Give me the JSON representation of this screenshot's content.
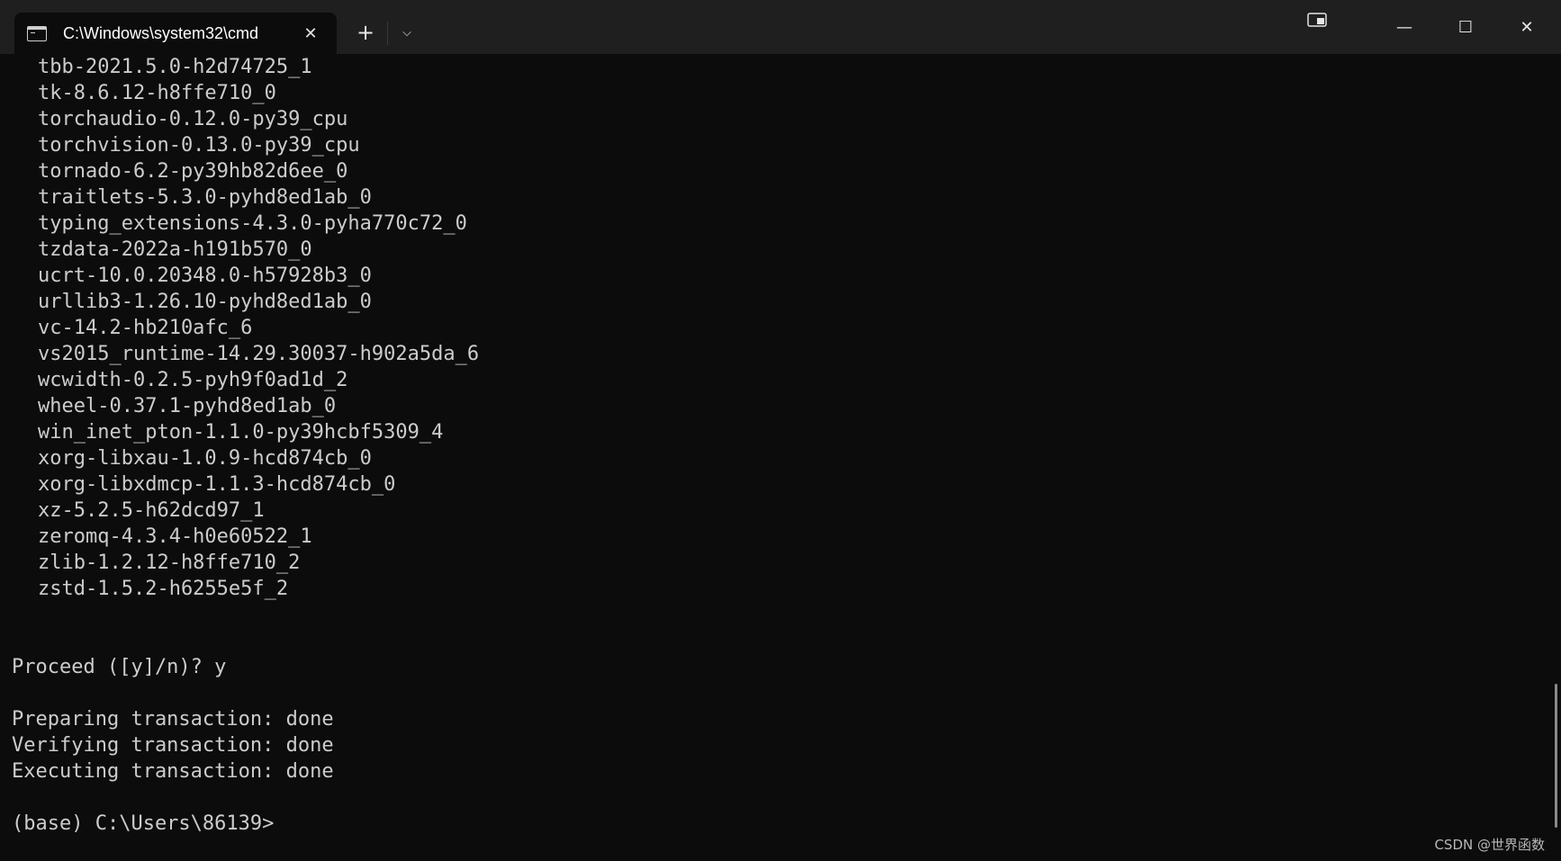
{
  "window": {
    "tab_title": "C:\\Windows\\system32\\cmd",
    "tab_close_glyph": "✕",
    "new_tab_glyph": "+",
    "dropdown_glyph": "⌵",
    "minimize_glyph": "—",
    "maximize_glyph": "☐",
    "close_glyph": "✕"
  },
  "terminal": {
    "packages": [
      "tbb-2021.5.0-h2d74725_1",
      "tk-8.6.12-h8ffe710_0",
      "torchaudio-0.12.0-py39_cpu",
      "torchvision-0.13.0-py39_cpu",
      "tornado-6.2-py39hb82d6ee_0",
      "traitlets-5.3.0-pyhd8ed1ab_0",
      "typing_extensions-4.3.0-pyha770c72_0",
      "tzdata-2022a-h191b570_0",
      "ucrt-10.0.20348.0-h57928b3_0",
      "urllib3-1.26.10-pyhd8ed1ab_0",
      "vc-14.2-hb210afc_6",
      "vs2015_runtime-14.29.30037-h902a5da_6",
      "wcwidth-0.2.5-pyh9f0ad1d_2",
      "wheel-0.37.1-pyhd8ed1ab_0",
      "win_inet_pton-1.1.0-py39hcbf5309_4",
      "xorg-libxau-1.0.9-hcd874cb_0",
      "xorg-libxdmcp-1.1.3-hcd874cb_0",
      "xz-5.2.5-h62dcd97_1",
      "zeromq-4.3.4-h0e60522_1",
      "zlib-1.2.12-h8ffe710_2",
      "zstd-1.5.2-h6255e5f_2"
    ],
    "proceed_prompt": "Proceed ([y]/n)? y",
    "status_lines": [
      "Preparing transaction: done",
      "Verifying transaction: done",
      "Executing transaction: done"
    ],
    "prompt": "(base) C:\\Users\\86139>"
  },
  "watermark": "CSDN @世界函数",
  "colors": {
    "background": "#0c0c0c",
    "titlebar": "#1f1f1f",
    "text": "#cccccc"
  },
  "icons": {
    "tab": "terminal-icon",
    "snap": "snap-layout-icon"
  }
}
